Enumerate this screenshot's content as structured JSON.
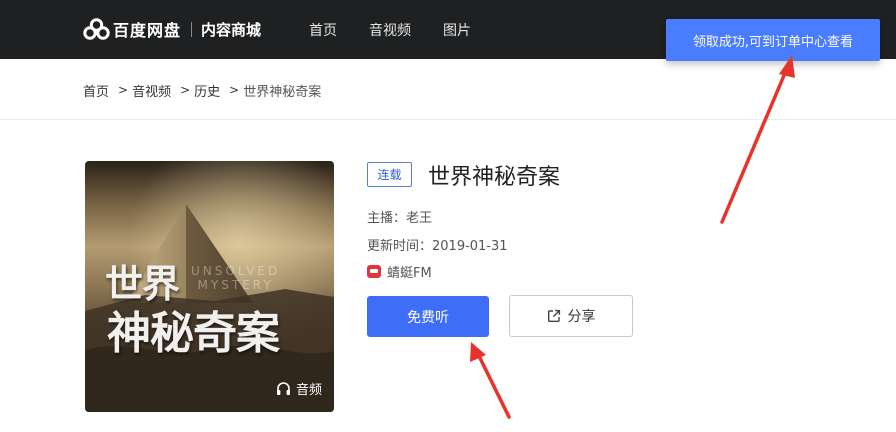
{
  "header": {
    "brand": "百度网盘",
    "sub_brand": "内容商城",
    "nav": [
      "首页",
      "音视频",
      "图片"
    ]
  },
  "toast": {
    "message": "领取成功,可到订单中心查看"
  },
  "breadcrumb": {
    "items": [
      "首页",
      "音视频",
      "历史"
    ],
    "current": "世界神秘奇案",
    "separator": ">"
  },
  "cover": {
    "title_line1": "世界",
    "title_line2": "神秘奇案",
    "english_line1": "UNSOLVED",
    "english_line2": "MYSTERY",
    "badge": "音频"
  },
  "album": {
    "tag": "连载",
    "title": "世界神秘奇案",
    "host": "主播：老王",
    "updated": "更新时间：2019-01-31",
    "platform": "蜻蜓FM"
  },
  "actions": {
    "listen_label": "免费听",
    "share_label": "分享"
  },
  "colors": {
    "topbar_bg": "#1f2021",
    "accent_blue": "#3e6ef7",
    "toast_blue": "#4a7cff",
    "tag_blue": "#2f5fd0",
    "annotation_red": "#e8332b"
  },
  "icons": [
    "baidu-cloud-logo-icon",
    "headphones-icon",
    "qingting-fm-icon",
    "share-external-icon",
    "annotation-arrow"
  ]
}
